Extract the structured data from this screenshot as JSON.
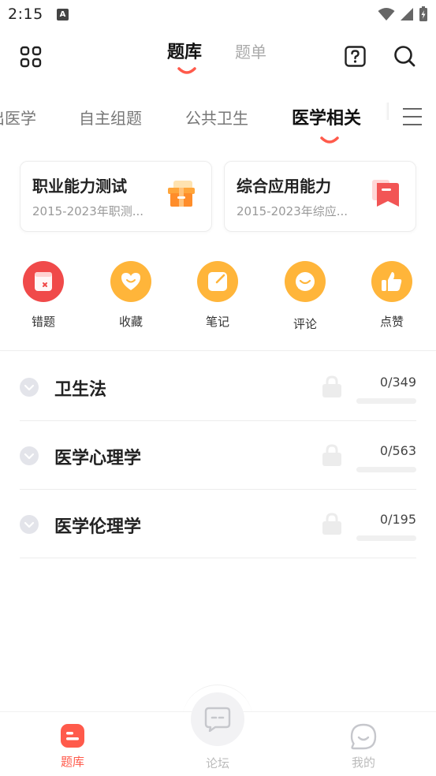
{
  "status_bar": {
    "time": "2:15",
    "app_badge": "A",
    "icons": [
      "wifi-icon",
      "signal-icon",
      "battery-charging-icon"
    ]
  },
  "header": {
    "tabs": [
      {
        "label": "题库",
        "active": true
      },
      {
        "label": "题单",
        "active": false
      }
    ],
    "icons": [
      "grid-icon",
      "help-icon",
      "search-icon"
    ]
  },
  "category_tabs": [
    {
      "label": "出医学",
      "active": false
    },
    {
      "label": "自主组题",
      "active": false
    },
    {
      "label": "公共卫生",
      "active": false
    },
    {
      "label": "医学相关",
      "active": true
    }
  ],
  "exam_cards": [
    {
      "title": "职业能力测试",
      "subtitle": "2015-2023年职测...",
      "icon": "gift-icon"
    },
    {
      "title": "综合应用能力",
      "subtitle": "2015-2023年综应...",
      "icon": "bookmark-icon"
    }
  ],
  "quick_actions": [
    {
      "label": "错题",
      "icon": "wrong-question-icon",
      "color": "#f04a4a"
    },
    {
      "label": "收藏",
      "icon": "heart-icon",
      "color": "#ffb53a"
    },
    {
      "label": "笔记",
      "icon": "note-icon",
      "color": "#ffb53a"
    },
    {
      "label": "评论",
      "icon": "comment-icon",
      "color": "#ffb53a"
    },
    {
      "label": "点赞",
      "icon": "thumbs-up-icon",
      "color": "#ffb53a"
    }
  ],
  "chapters": [
    {
      "name": "卫生法",
      "progress_text": "0/349",
      "done": 0,
      "total": 349,
      "locked": true
    },
    {
      "name": "医学心理学",
      "progress_text": "0/563",
      "done": 0,
      "total": 563,
      "locked": true
    },
    {
      "name": "医学伦理学",
      "progress_text": "0/195",
      "done": 0,
      "total": 195,
      "locked": true
    }
  ],
  "bottom_nav": [
    {
      "label": "题库",
      "icon": "question-bank-icon",
      "active": true
    },
    {
      "label": "论坛",
      "icon": "forum-icon",
      "active": false
    },
    {
      "label": "我的",
      "icon": "profile-icon",
      "active": false
    }
  ],
  "colors": {
    "accent": "#ff5a4b",
    "orange": "#ffb53a",
    "red": "#f04a4a"
  }
}
